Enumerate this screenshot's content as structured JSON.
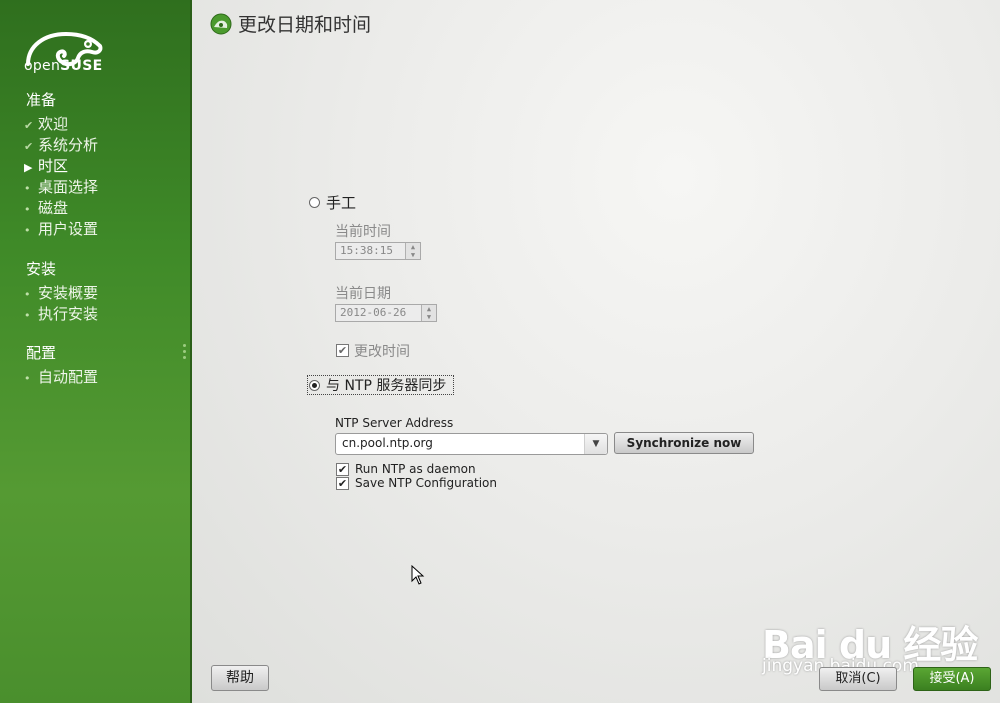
{
  "sidebar": {
    "logo_prefix": "open",
    "logo_suffix": "SUSE",
    "sections": [
      {
        "title": "准备",
        "items": [
          {
            "label": "欢迎",
            "state": "done"
          },
          {
            "label": "系统分析",
            "state": "done"
          },
          {
            "label": "时区",
            "state": "current"
          },
          {
            "label": "桌面选择",
            "state": "pending"
          },
          {
            "label": "磁盘",
            "state": "pending"
          },
          {
            "label": "用户设置",
            "state": "pending"
          }
        ]
      },
      {
        "title": "安装",
        "items": [
          {
            "label": "安装概要",
            "state": "pending"
          },
          {
            "label": "执行安装",
            "state": "pending"
          }
        ]
      },
      {
        "title": "配置",
        "items": [
          {
            "label": "自动配置",
            "state": "pending"
          }
        ]
      }
    ]
  },
  "header": {
    "title": "更改日期和时间"
  },
  "manual": {
    "label": "手工",
    "selected": false,
    "current_time_label": "当前时间",
    "current_time_value": "15:38:15",
    "current_date_label": "当前日期",
    "current_date_value": "2012-06-26",
    "change_time_label": "更改时间",
    "change_time_checked": true
  },
  "ntp": {
    "label": "与 NTP 服务器同步",
    "selected": true,
    "server_address_label": "NTP Server Address",
    "server_address_value": "cn.pool.ntp.org",
    "sync_button": "Synchronize now",
    "run_daemon_label": "Run NTP as daemon",
    "run_daemon_checked": true,
    "save_config_label": "Save NTP Configuration",
    "save_config_checked": true
  },
  "footer": {
    "help": "帮助",
    "cancel": "取消(C)",
    "accept": "接受(A)"
  },
  "watermark": {
    "brand": "Bai du 经验",
    "url": "jingyan.baidu.com"
  },
  "colors": {
    "sidebar_green": "#3f8a28",
    "accept_green": "#4a9429"
  }
}
